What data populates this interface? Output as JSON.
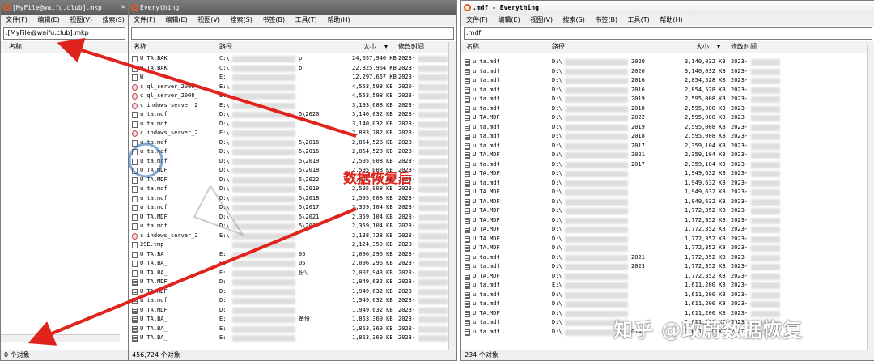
{
  "window1": {
    "title": "[MyFile@waifu.club].mkp",
    "menu": [
      "文件(F)",
      "编辑(E)",
      "视图(V)",
      "搜索(S)",
      "书"
    ],
    "search_value": ".[MyFile@waifu.club].mkp",
    "header_name": "名称",
    "status": "0 个对象"
  },
  "window2": {
    "title": "Everything",
    "menu": [
      "文件(F)",
      "编辑(E)",
      "视图(V)",
      "搜索(S)",
      "书签(B)",
      "工具(T)",
      "帮助(H)"
    ],
    "headers": {
      "name": "名称",
      "path": "路径",
      "size": "大小",
      "modified": "修改时间"
    },
    "status": "456,724 个对象",
    "rows": [
      {
        "name": "U  TA.BAK",
        "path": "C:\\",
        "pathtail": "p",
        "size": "24,057,940 KB",
        "date": "2023-",
        "icon": "file"
      },
      {
        "name": "U  TA.BAK",
        "path": "C:\\",
        "pathtail": "p",
        "size": "22,825,964 KB",
        "date": "2023-",
        "icon": "file"
      },
      {
        "name": "W",
        "path": "E:",
        "pathtail": "",
        "size": "12,297,657 KB",
        "date": "2023-",
        "icon": "file"
      },
      {
        "name": "c  ql_server_2008_",
        "path": "E:\\",
        "pathtail": "",
        "size": "4,553,598 KB",
        "date": "2020-",
        "icon": "iso"
      },
      {
        "name": "c  ql_server_2008_",
        "path": "E:\\",
        "pathtail": "",
        "size": "4,553,598 KB",
        "date": "2023-",
        "icon": "iso"
      },
      {
        "name": "c  indows_server_2",
        "path": "E:\\",
        "pathtail": "",
        "size": "3,193,688 KB",
        "date": "2023-",
        "icon": "iso"
      },
      {
        "name": "u  ta.mdf",
        "path": "D:\\",
        "pathtail": "5\\2020",
        "size": "3,140,032 KB",
        "date": "2023-",
        "icon": "file"
      },
      {
        "name": "u  ta.mdf",
        "path": "D:\\",
        "pathtail": "",
        "size": "3,140,032 KB",
        "date": "2023-",
        "icon": "file"
      },
      {
        "name": "c  indows_server_2",
        "path": "E:\\",
        "pathtail": "",
        "size": "2,883,782 KB",
        "date": "2023-",
        "icon": "iso"
      },
      {
        "name": "u  ta.mdf",
        "path": "D:\\",
        "pathtail": "5\\2016",
        "size": "2,854,528 KB",
        "date": "2023-",
        "icon": "file"
      },
      {
        "name": "u  ta.mdf",
        "path": "D:\\",
        "pathtail": "5\\2016",
        "size": "2,854,528 KB",
        "date": "2023-",
        "icon": "file"
      },
      {
        "name": "u  ta.mdf",
        "path": "D:\\",
        "pathtail": "5\\2019",
        "size": "2,595,008 KB",
        "date": "2023-",
        "icon": "file"
      },
      {
        "name": "U  TA.MDF",
        "path": "D:\\",
        "pathtail": "5\\2018",
        "size": "2,595,008 KB",
        "date": "2023-",
        "icon": "file"
      },
      {
        "name": "U  TA.MDF",
        "path": "D:\\",
        "pathtail": "5\\2022",
        "size": "2,595,008 KB",
        "date": "2023-",
        "icon": "file"
      },
      {
        "name": "u  ta.mdf",
        "path": "D:\\",
        "pathtail": "5\\2019",
        "size": "2,595,008 KB",
        "date": "2023-",
        "icon": "file"
      },
      {
        "name": "u  ta.mdf",
        "path": "D:\\",
        "pathtail": "5\\2018",
        "size": "2,595,008 KB",
        "date": "2023-",
        "icon": "file"
      },
      {
        "name": "u  ta.mdf",
        "path": "D:\\",
        "pathtail": "5\\2017",
        "size": "2,359,104 KB",
        "date": "2023-",
        "icon": "file"
      },
      {
        "name": "U  TA.MDF",
        "path": "D:\\",
        "pathtail": "5\\2021",
        "size": "2,359,104 KB",
        "date": "2023-",
        "icon": "file"
      },
      {
        "name": "u  ta.mdf",
        "path": "D:\\",
        "pathtail": "5\\2017",
        "size": "2,359,104 KB",
        "date": "2023-",
        "icon": "file"
      },
      {
        "name": "c  indows_server_2",
        "path": "E:\\",
        "pathtail": "",
        "size": "2,138,728 KB",
        "date": "2023-",
        "icon": "iso"
      },
      {
        "name": "  29E.tmp",
        "path": "",
        "pathtail": "",
        "size": "2,124,359 KB",
        "date": "2023-",
        "icon": "file"
      },
      {
        "name": "U  TA.BA_",
        "path": "E:",
        "pathtail": "05",
        "size": "2,096,296 KB",
        "date": "2023-",
        "icon": "file"
      },
      {
        "name": "U  TA.BA_",
        "path": "E:",
        "pathtail": "05",
        "size": "2,096,296 KB",
        "date": "2023-",
        "icon": "file"
      },
      {
        "name": "U  TA.BA_",
        "path": "E:",
        "pathtail": "份\\",
        "size": "2,007,943 KB",
        "date": "2023-",
        "icon": "file"
      },
      {
        "name": "U  TA.MDF",
        "path": "D:",
        "pathtail": "",
        "size": "1,949,632 KB",
        "date": "2023-",
        "icon": "mdf"
      },
      {
        "name": "U  TA.MDF",
        "path": "D:",
        "pathtail": "",
        "size": "1,949,632 KB",
        "date": "2023-",
        "icon": "mdf"
      },
      {
        "name": "u  ta.mdf",
        "path": "D:",
        "pathtail": "",
        "size": "1,949,632 KB",
        "date": "2023-",
        "icon": "mdf"
      },
      {
        "name": "U  TA.MDF",
        "path": "D:",
        "pathtail": "",
        "size": "1,949,632 KB",
        "date": "2023-",
        "icon": "mdf"
      },
      {
        "name": "U  TA.BA_",
        "path": "E:",
        "pathtail": "备份",
        "size": "1,853,369 KB",
        "date": "2023-",
        "icon": "mdf"
      },
      {
        "name": "U  TA.BA_",
        "path": "E:",
        "pathtail": "",
        "size": "1,853,369 KB",
        "date": "2023-",
        "icon": "mdf"
      },
      {
        "name": "U  TA.BA_",
        "path": "E:",
        "pathtail": "",
        "size": "1,853,369 KB",
        "date": "2023-",
        "icon": "mdf"
      }
    ]
  },
  "window3": {
    "title": ".mdf - Everything",
    "menu": [
      "文件(F)",
      "编辑(E)",
      "视图(V)",
      "搜索(S)",
      "书签(B)",
      "工具(T)",
      "帮助(H)"
    ],
    "search_value": ".mdf",
    "headers": {
      "name": "名称",
      "path": "路径",
      "size": "大小",
      "modified": "修改时间"
    },
    "status": "234 个对象",
    "rows": [
      {
        "name": "u  ta.mdf",
        "path": "D:\\",
        "pathtail": "2020",
        "size": "3,140,032 KB",
        "date": "2023-"
      },
      {
        "name": "u  ta.mdf",
        "path": "D:\\",
        "pathtail": "2020",
        "size": "3,140,032 KB",
        "date": "2023-"
      },
      {
        "name": "u  ta.mdf",
        "path": "D:\\",
        "pathtail": "2016",
        "size": "2,854,528 KB",
        "date": "2023-"
      },
      {
        "name": "u  ta.mdf",
        "path": "D:\\",
        "pathtail": "2016",
        "size": "2,854,528 KB",
        "date": "2023-"
      },
      {
        "name": "u  ta.mdf",
        "path": "D:\\",
        "pathtail": "2019",
        "size": "2,595,008 KB",
        "date": "2023-"
      },
      {
        "name": "u  ta.mdf",
        "path": "D:\\",
        "pathtail": "2018",
        "size": "2,595,008 KB",
        "date": "2023-"
      },
      {
        "name": "U  TA.MDF",
        "path": "D:\\",
        "pathtail": "2022",
        "size": "2,595,008 KB",
        "date": "2023-"
      },
      {
        "name": "u  ta.mdf",
        "path": "D:\\",
        "pathtail": "2019",
        "size": "2,595,008 KB",
        "date": "2023-"
      },
      {
        "name": "u  ta.mdf",
        "path": "D:\\",
        "pathtail": "2018",
        "size": "2,595,008 KB",
        "date": "2023-"
      },
      {
        "name": "u  ta.mdf",
        "path": "D:\\",
        "pathtail": "2017",
        "size": "2,359,104 KB",
        "date": "2023-"
      },
      {
        "name": "U  TA.MDF",
        "path": "D:\\",
        "pathtail": "2021",
        "size": "2,359,104 KB",
        "date": "2023-"
      },
      {
        "name": "u  ta.mdf",
        "path": "D:\\",
        "pathtail": "2017",
        "size": "2,359,104 KB",
        "date": "2023-"
      },
      {
        "name": "U  TA.MDF",
        "path": "D:\\",
        "pathtail": "",
        "size": "1,949,632 KB",
        "date": "2023-"
      },
      {
        "name": "u  ta.mdf",
        "path": "D:\\",
        "pathtail": "",
        "size": "1,949,632 KB",
        "date": "2023-"
      },
      {
        "name": "U  TA.MDF",
        "path": "D:\\",
        "pathtail": "",
        "size": "1,949,632 KB",
        "date": "2023-"
      },
      {
        "name": "U  TA.MDF",
        "path": "D:\\",
        "pathtail": "",
        "size": "1,949,632 KB",
        "date": "2023-"
      },
      {
        "name": "U  TA.MDF",
        "path": "D:\\",
        "pathtail": "",
        "size": "1,772,352 KB",
        "date": "2023-"
      },
      {
        "name": "U  TA.MDF",
        "path": "D:\\",
        "pathtail": "",
        "size": "1,772,352 KB",
        "date": "2023-"
      },
      {
        "name": "U  TA.MDF",
        "path": "D:\\",
        "pathtail": "",
        "size": "1,772,352 KB",
        "date": "2023-"
      },
      {
        "name": "U  TA.MDF",
        "path": "D:\\",
        "pathtail": "",
        "size": "1,772,352 KB",
        "date": "2023-"
      },
      {
        "name": "U  TA.MDF",
        "path": "D:\\",
        "pathtail": "",
        "size": "1,772,352 KB",
        "date": "2023-"
      },
      {
        "name": "u  ta.mdf",
        "path": "D:\\",
        "pathtail": "2021",
        "size": "1,772,352 KB",
        "date": "2023-"
      },
      {
        "name": "u  ta.mdf",
        "path": "D:\\",
        "pathtail": "2023",
        "size": "1,772,352 KB",
        "date": "2023-"
      },
      {
        "name": "U  TA.MDF",
        "path": "D:\\",
        "pathtail": "",
        "size": "1,772,352 KB",
        "date": "2023-"
      },
      {
        "name": "u  ta.mdf",
        "path": "E:\\",
        "pathtail": "",
        "size": "1,611,200 KB",
        "date": "2023-"
      },
      {
        "name": "u  ta.mdf",
        "path": "D:\\",
        "pathtail": "",
        "size": "1,611,200 KB",
        "date": "2023-"
      },
      {
        "name": "u  ta.mdf",
        "path": "D:\\",
        "pathtail": "",
        "size": "1,611,200 KB",
        "date": "2023-"
      },
      {
        "name": "U  TA.MDF",
        "path": "D:\\",
        "pathtail": "",
        "size": "1,611,200 KB",
        "date": "2023-"
      },
      {
        "name": "u  ta.mdf",
        "path": "D:\\",
        "pathtail": "",
        "size": "1,611,200 KB",
        "date": "2023-"
      },
      {
        "name": "u  ta.mdf",
        "path": "D:\\",
        "pathtail": "014",
        "size": "1,611,200 KB",
        "date": "2023-"
      }
    ]
  },
  "annotation": {
    "text": "数据恢复后",
    "color": "#e0231c"
  },
  "watermark": {
    "text": "知乎 @政蔚数据恢复"
  },
  "colors": {
    "arrow": "#e0231c",
    "accent": "#e65a1e"
  }
}
